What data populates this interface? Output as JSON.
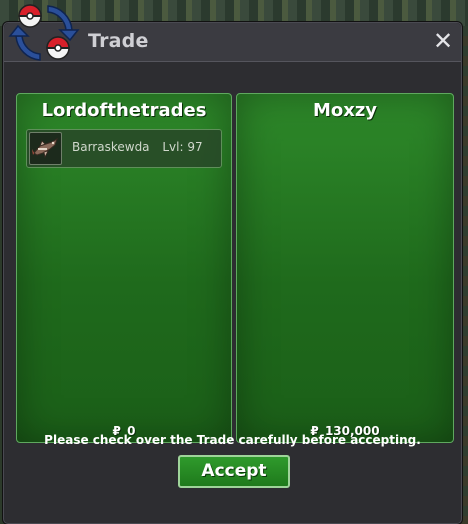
{
  "window": {
    "title": "Trade",
    "close_label": "✕"
  },
  "icons": {
    "trade_logo": "pokeball-trade-arrows-icon",
    "close": "close-icon",
    "item": "barraskewda-sprite-icon",
    "currency": "pokedollar-icon"
  },
  "colors": {
    "panel_green": "#1f6a1c",
    "panel_border": "#5fa85f",
    "accept_green": "#2f9a2c",
    "window_dark": "#2d2d31"
  },
  "left_panel": {
    "name": "Lordofthetrades",
    "items": [
      {
        "name": "Barraskewda",
        "level": "Lvl: 97"
      }
    ],
    "currency_symbol": "₽",
    "money": "0"
  },
  "right_panel": {
    "name": "Moxzy",
    "items": [],
    "currency_symbol": "₽",
    "money": "130,000"
  },
  "footer": {
    "message": "Please check over the Trade carefully before accepting.",
    "accept_label": "Accept"
  }
}
